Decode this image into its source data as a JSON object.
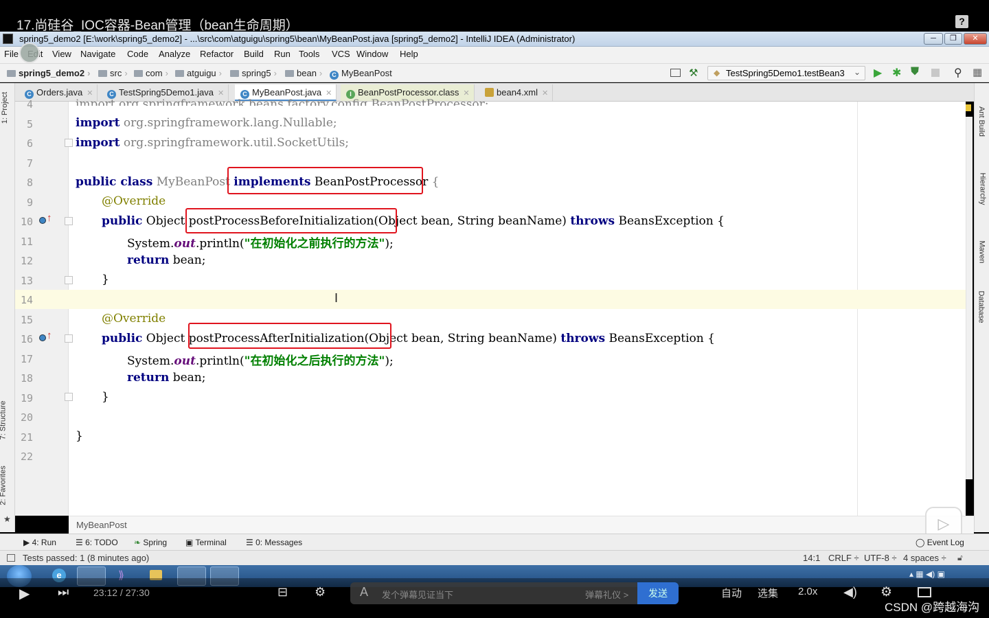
{
  "video": {
    "title": "17.尚硅谷_IOC容器-Bean管理（bean生命周期）",
    "help_glyph": "?"
  },
  "ide": {
    "window_title": "spring5_demo2 [E:\\work\\spring5_demo2] - ...\\src\\com\\atguigu\\spring5\\bean\\MyBeanPost.java [spring5_demo2] - IntelliJ IDEA (Administrator)",
    "menu": [
      "File",
      "Edit",
      "View",
      "Navigate",
      "Code",
      "Analyze",
      "Refactor",
      "Build",
      "Run",
      "Tools",
      "VCS",
      "Window",
      "Help"
    ],
    "breadcrumbs": [
      "spring5_demo2",
      "src",
      "com",
      "atguigu",
      "spring5",
      "bean",
      "MyBeanPost"
    ],
    "run_config": "TestSpring5Demo1.testBean3",
    "tabs": [
      {
        "label": "Orders.java",
        "icon": "class-icon"
      },
      {
        "label": "TestSpring5Demo1.java",
        "icon": "class-icon"
      },
      {
        "label": "MyBeanPost.java",
        "icon": "class-icon"
      },
      {
        "label": "BeanPostProcessor.class",
        "icon": "interface-icon"
      },
      {
        "label": "bean4.xml",
        "icon": "xml-icon"
      }
    ],
    "left_tools": [
      "1: Project",
      "7: Structure",
      "2: Favorites"
    ],
    "right_tools": [
      "Ant Build",
      "Hierarchy",
      "Maven",
      "Database"
    ],
    "editor_breadcrumb": "MyBeanPost",
    "bottom_tools": [
      "4: Run",
      "6: TODO",
      "Spring",
      "Terminal",
      "0: Messages",
      "Event Log"
    ],
    "status": {
      "message": "Tests passed: 1 (8 minutes ago)",
      "position": "14:1",
      "line_sep": "CRLF ÷",
      "encoding": "UTF-8 ÷",
      "indent": "4 spaces ÷"
    }
  },
  "code": {
    "line_numbers": [
      "4",
      "5",
      "6",
      "7",
      "8",
      "9",
      "10",
      "11",
      "12",
      "13",
      "14",
      "15",
      "16",
      "17",
      "18",
      "19",
      "20",
      "21",
      "22"
    ],
    "line4": "import org.springframework.beans.factory.config.BeanPostProcessor;",
    "line5_kw": "import",
    "line5_rest": " org.springframework.lang.Nullable;",
    "line6_kw": "import",
    "line6_rest": " org.springframework.util.SocketUtils;",
    "line8_kw": "public class",
    "line8_name": " MyBeanPost ",
    "line8_impl": "implements",
    "line8_iface": " BeanPostProcessor",
    "line8_brace": " {",
    "override": "@Override",
    "method_prefix_kw": "public",
    "method_prefix_type": " Object ",
    "before_name": "postProcessBeforeInitialization",
    "after_name": "postProcessAfterInitialization",
    "params": "(Object bean, String beanName) ",
    "throws_kw": "throws",
    "exception": " BeansException {",
    "sysout_a": "System.",
    "sysout_out": "out",
    "sysout_b": ".println(",
    "before_msg": "\"在初始化之前执行的方法\"",
    "after_msg": "\"在初始化之后执行的方法\"",
    "sysout_end": ");",
    "return_kw": "return",
    "return_rest": " bean;",
    "close_brace": "}"
  },
  "player": {
    "time_current": "23:12",
    "time_total": "27:30",
    "danmaku_placeholder": "发个弹幕见证当下",
    "danmaku_etiquette": "弹幕礼仪 >",
    "send_label": "发送",
    "auto_label": "自动",
    "episodes_label": "选集",
    "speed_label": "2.0x",
    "watermark": "CSDN @跨越海沟"
  }
}
